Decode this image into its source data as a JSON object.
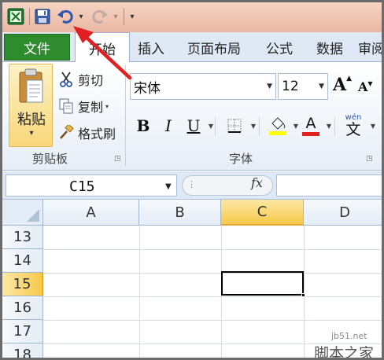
{
  "qat": {
    "customize_glyph": "▾",
    "dropdown_glyph": "▾"
  },
  "tabs": [
    {
      "label": "文件"
    },
    {
      "label": "开始"
    },
    {
      "label": "插入"
    },
    {
      "label": "页面布局"
    },
    {
      "label": "公式"
    },
    {
      "label": "数据"
    },
    {
      "label": "审阅"
    }
  ],
  "clipboard": {
    "paste_label": "粘贴",
    "paste_arrow": "▾",
    "cut_label": "剪切",
    "copy_label": "复制",
    "copy_arrow": "▾",
    "format_painter_label": "格式刷",
    "group_label": "剪贴板"
  },
  "font": {
    "name": "宋体",
    "size": "12",
    "grow_label": "A",
    "shrink_label": "A",
    "bold": "B",
    "italic": "I",
    "underline": "U",
    "font_color_glyph": "A",
    "phonetic_top": "wén",
    "phonetic_glyph": "文",
    "group_label": "字体"
  },
  "formula_bar": {
    "name_box": "C15",
    "fx": "fx",
    "formula": ""
  },
  "grid": {
    "columns": [
      "A",
      "B",
      "C",
      "D"
    ],
    "rows": [
      "13",
      "14",
      "15",
      "16",
      "17",
      "18"
    ],
    "selected_column": "C",
    "selected_row": "15",
    "active_cell": "C15"
  },
  "watermark": {
    "site": "jb51.net",
    "name": "脚本之家"
  },
  "colors": {
    "file_tab": "#2e8b2e",
    "selection_header": "#f6c94a",
    "annotation_arrow": "#e02020",
    "font_color_bar": "#e02020",
    "highlight_bar": "#ffff00"
  }
}
